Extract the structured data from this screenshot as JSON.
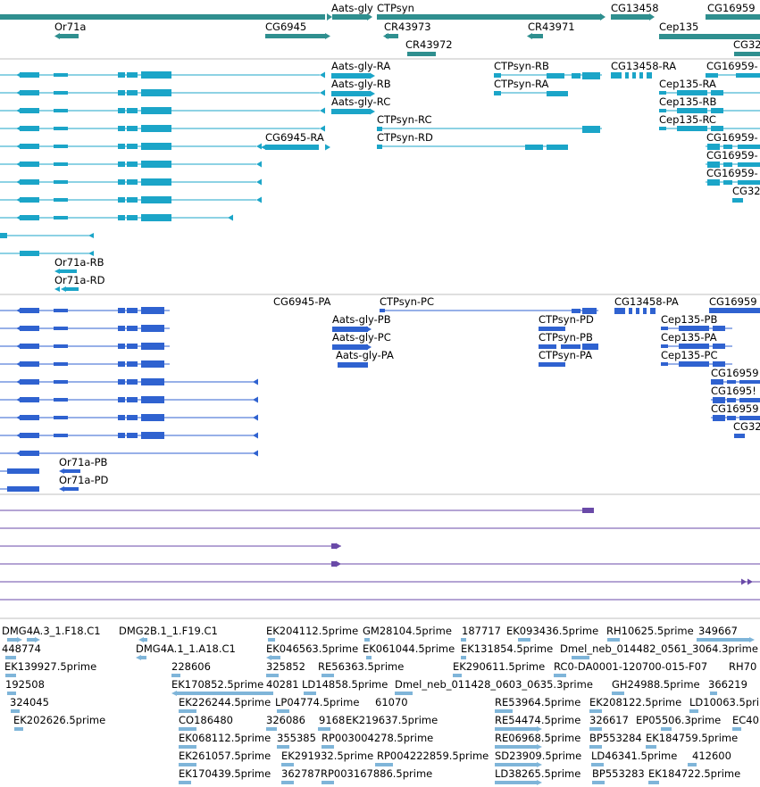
{
  "colors": {
    "gene": "#2f8f8f",
    "transcript": "#1ba5c8",
    "protein": "#2f62d0",
    "alignment": "#6a4aa8",
    "est": "#7fb5d9",
    "separator": "#bfbfbf"
  },
  "tracks": {
    "genes": {
      "features": [
        {
          "name": "Aats-gly"
        },
        {
          "name": "CTPsyn"
        },
        {
          "name": "CG13458"
        },
        {
          "name": "CG16959"
        },
        {
          "name": "Or71a"
        },
        {
          "name": "CG6945"
        },
        {
          "name": "CR43973"
        },
        {
          "name": "CR43971"
        },
        {
          "name": "Cep135"
        },
        {
          "name": "CR43972"
        },
        {
          "name": "CG32"
        }
      ]
    },
    "transcripts": {
      "features": [
        {
          "name": "Aats-gly-RA"
        },
        {
          "name": "CTPsyn-RB"
        },
        {
          "name": "CG13458-RA"
        },
        {
          "name": "CG16959-"
        },
        {
          "name": "Aats-gly-RB"
        },
        {
          "name": "CTPsyn-RA"
        },
        {
          "name": "Cep135-RA"
        },
        {
          "name": "Aats-gly-RC"
        },
        {
          "name": "Cep135-RB"
        },
        {
          "name": "CTPsyn-RC"
        },
        {
          "name": "Cep135-RC"
        },
        {
          "name": "CG6945-RA"
        },
        {
          "name": "CTPsyn-RD"
        },
        {
          "name": "CG16959-"
        },
        {
          "name": "CG16959-"
        },
        {
          "name": "CG16959-"
        },
        {
          "name": "CG32"
        },
        {
          "name": "Or71a-RB"
        },
        {
          "name": "Or71a-RD"
        }
      ]
    },
    "proteins": {
      "features": [
        {
          "name": "CG6945-PA"
        },
        {
          "name": "CTPsyn-PC"
        },
        {
          "name": "CG13458-PA"
        },
        {
          "name": "CG16959"
        },
        {
          "name": "Aats-gly-PB"
        },
        {
          "name": "CTPsyn-PD"
        },
        {
          "name": "Cep135-PB"
        },
        {
          "name": "Aats-gly-PC"
        },
        {
          "name": "CTPsyn-PB"
        },
        {
          "name": "Cep135-PA"
        },
        {
          "name": "Aats-gly-PA"
        },
        {
          "name": "CTPsyn-PA"
        },
        {
          "name": "Cep135-PC"
        },
        {
          "name": "CG16959"
        },
        {
          "name": "CG1695!"
        },
        {
          "name": "CG16959"
        },
        {
          "name": "CG32"
        },
        {
          "name": "Or71a-PB"
        },
        {
          "name": "Or71a-PD"
        }
      ]
    },
    "ests": {
      "features": [
        {
          "name": "DMG4A.3_1.F18.C1"
        },
        {
          "name": "DMG2B.1_1.F19.C1"
        },
        {
          "name": "EK204112.5prime"
        },
        {
          "name": "GM28104.5prime"
        },
        {
          "name": "187717"
        },
        {
          "name": "EK093436.5prime"
        },
        {
          "name": "RH10625.5prime"
        },
        {
          "name": "349667"
        },
        {
          "name": "448774"
        },
        {
          "name": "DMG4A.1_1.A18.C1"
        },
        {
          "name": "EK046563.5prime"
        },
        {
          "name": "EK061044.5prime"
        },
        {
          "name": "EK131854.5prime"
        },
        {
          "name": "Dmel_neb_014482_0561_3064.3prime"
        },
        {
          "name": "EK139927.5prime"
        },
        {
          "name": "228606"
        },
        {
          "name": "325852"
        },
        {
          "name": "RE56363.5prime"
        },
        {
          "name": "EK290611.5prime"
        },
        {
          "name": "RC0-DA0001-120700-015-F07"
        },
        {
          "name": "RH70"
        },
        {
          "name": "192508"
        },
        {
          "name": "EK170852.5prime"
        },
        {
          "name": "40281"
        },
        {
          "name": "LD14858.5prime"
        },
        {
          "name": "Dmel_neb_011428_0603_0635.3prime"
        },
        {
          "name": "GH24988.5prime"
        },
        {
          "name": "366219"
        },
        {
          "name": "324045"
        },
        {
          "name": "EK226244.5prime"
        },
        {
          "name": "LP04774.5prime"
        },
        {
          "name": "61070"
        },
        {
          "name": "RE53964.5prime"
        },
        {
          "name": "EK208122.5prime"
        },
        {
          "name": "LD10063.5prime"
        },
        {
          "name": "EK202626.5prime"
        },
        {
          "name": "CO186480"
        },
        {
          "name": "326086"
        },
        {
          "name": "9168"
        },
        {
          "name": "EK219637.5prime"
        },
        {
          "name": "RE54474.5prime"
        },
        {
          "name": "326617"
        },
        {
          "name": "EP05506.3prime"
        },
        {
          "name": "EC40"
        },
        {
          "name": "EK068112.5prime"
        },
        {
          "name": "355385"
        },
        {
          "name": "RP003004278.5prime"
        },
        {
          "name": "RE06968.5prime"
        },
        {
          "name": "BP553284"
        },
        {
          "name": "EK184759.5prime"
        },
        {
          "name": "EK261057.5prime"
        },
        {
          "name": "EK291932.5prime"
        },
        {
          "name": "RP004222859.5prime"
        },
        {
          "name": "SD23909.5prime"
        },
        {
          "name": "LD46341.5prime"
        },
        {
          "name": "412600"
        },
        {
          "name": "EK170439.5prime"
        },
        {
          "name": "362787"
        },
        {
          "name": "RP003167886.5prime"
        },
        {
          "name": "LD38265.5prime"
        },
        {
          "name": "BP553283"
        },
        {
          "name": "EK184722.5prime"
        }
      ]
    }
  }
}
